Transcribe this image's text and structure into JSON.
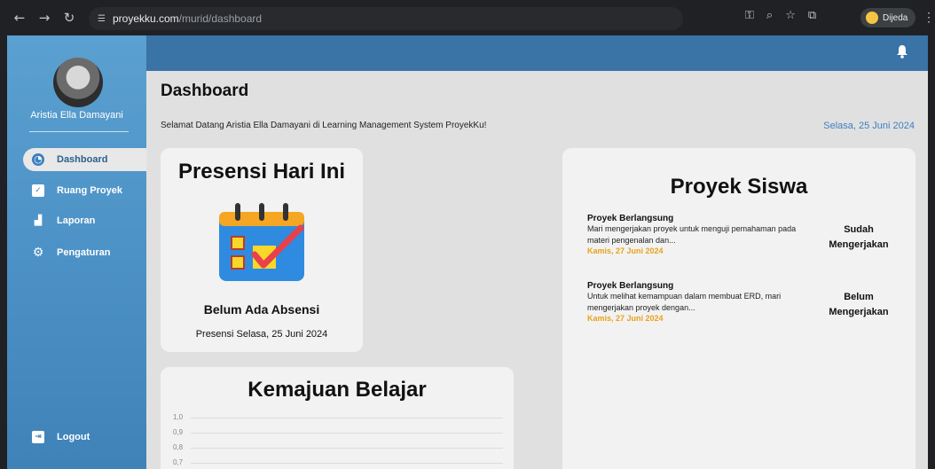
{
  "browser": {
    "url_host": "proyekku.com",
    "url_path": "/murid/dashboard",
    "profile_name": "Dijeda"
  },
  "sidebar": {
    "user_name": "Aristia Ella Damayani",
    "items": [
      {
        "label": "Dashboard",
        "icon": "dashboard-icon",
        "active": true
      },
      {
        "label": "Ruang Proyek",
        "icon": "file-icon",
        "active": false
      },
      {
        "label": "Laporan",
        "icon": "chart-icon",
        "active": false
      },
      {
        "label": "Pengaturan",
        "icon": "gear-icon",
        "active": false
      }
    ],
    "logout_label": "Logout"
  },
  "header": {
    "title": "Dashboard",
    "welcome": "Selamat Datang Aristia Ella Damayani di Learning Management System ProyekKu!",
    "date": "Selasa, 25 Juni 2024"
  },
  "presensi": {
    "title": "Presensi Hari Ini",
    "status": "Belum Ada Absensi",
    "date_label": "Presensi Selasa, 25 Juni 2024"
  },
  "kemajuan": {
    "title": "Kemajuan Belajar",
    "ticks": [
      "1,0",
      "0,9",
      "0,8",
      "0,7"
    ]
  },
  "proyek": {
    "title": "Proyek Siswa",
    "items": [
      {
        "heading": "Proyek Berlangsung",
        "desc": "Mari mengerjakan proyek untuk menguji pemahaman pada materi pengenalan dan...",
        "date": "Kamis, 27 Juni 2024",
        "status": "Sudah Mengerjakan"
      },
      {
        "heading": "Proyek Berlangsung",
        "desc": "Untuk melihat kemampuan dalam membuat ERD, mari mengerjakan proyek dengan...",
        "date": "Kamis, 27 Juni 2024",
        "status": "Belum Mengerjakan"
      }
    ]
  },
  "colors": {
    "sidebar": "#4a8fc4",
    "topbar": "#3a73a6",
    "accent_date": "#e8a31a"
  }
}
